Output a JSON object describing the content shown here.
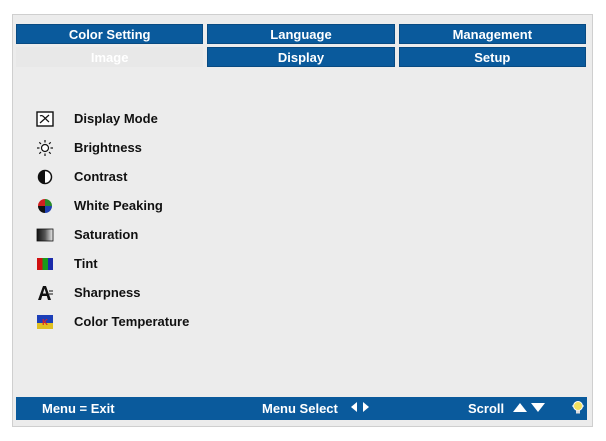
{
  "tabs": [
    {
      "label": "Color Setting"
    },
    {
      "label": "Language"
    },
    {
      "label": "Management"
    },
    {
      "label": "Image"
    },
    {
      "label": "Display"
    },
    {
      "label": "Setup"
    }
  ],
  "menu": {
    "items": [
      {
        "label": "Display Mode",
        "icon": "display-mode-icon"
      },
      {
        "label": "Brightness",
        "icon": "brightness-icon"
      },
      {
        "label": "Contrast",
        "icon": "contrast-icon"
      },
      {
        "label": "White Peaking",
        "icon": "white-peaking-icon"
      },
      {
        "label": "Saturation",
        "icon": "saturation-icon"
      },
      {
        "label": "Tint",
        "icon": "tint-icon"
      },
      {
        "label": "Sharpness",
        "icon": "sharpness-icon"
      },
      {
        "label": "Color Temperature",
        "icon": "color-temperature-icon"
      }
    ]
  },
  "footer": {
    "exit_label": "Menu = Exit",
    "select_label": "Menu Select",
    "scroll_label": "Scroll"
  },
  "colors": {
    "accent": "#0a5a9c",
    "panel": "#ececec"
  }
}
